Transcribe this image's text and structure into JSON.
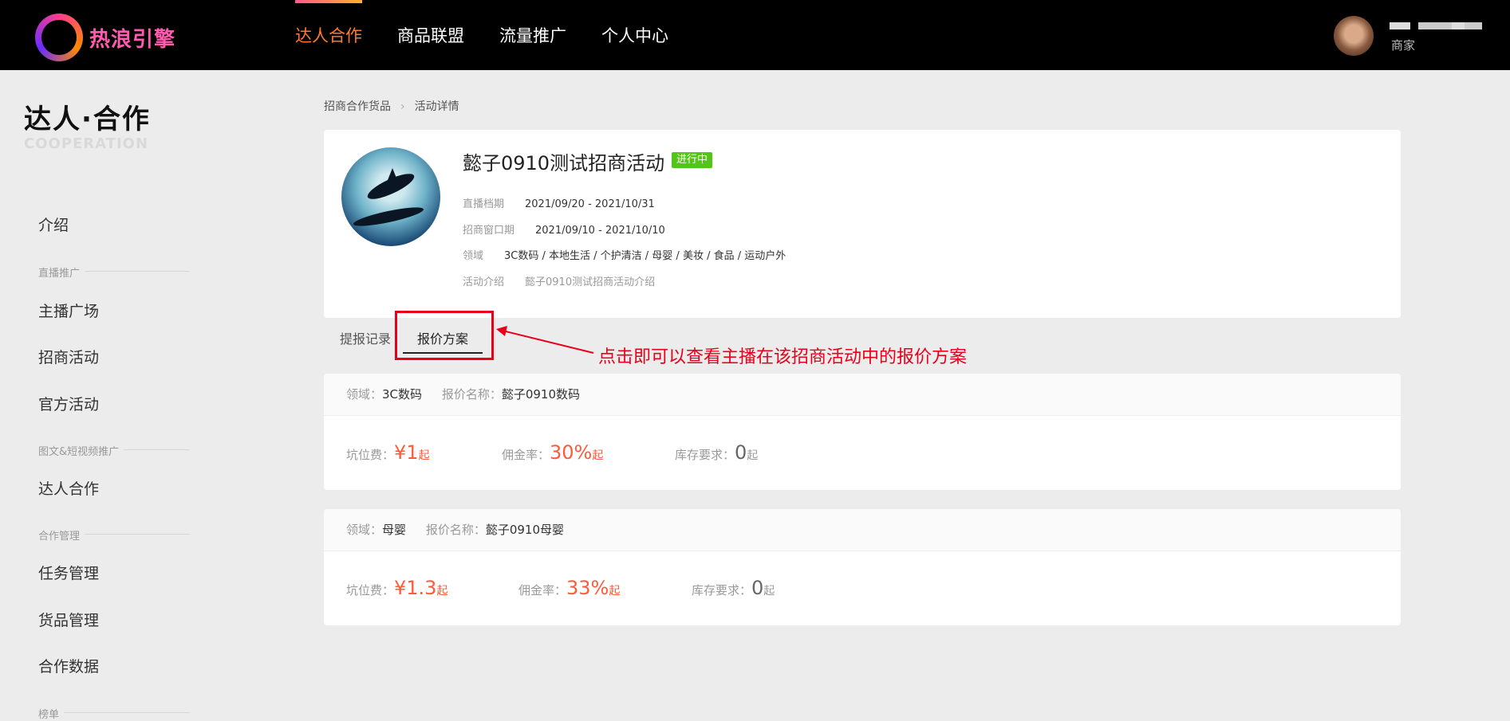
{
  "header": {
    "logo_text": "热浪引擎",
    "nav": [
      {
        "label": "达人合作",
        "active": true
      },
      {
        "label": "商品联盟",
        "active": false
      },
      {
        "label": "流量推广",
        "active": false
      },
      {
        "label": "个人中心",
        "active": false
      }
    ],
    "user_role": "商家"
  },
  "sidebar": {
    "title": "达人·合作",
    "subtitle": "COOPERATION",
    "intro": "介绍",
    "group_live": "直播推广",
    "live_items": [
      "主播广场",
      "招商活动",
      "官方活动"
    ],
    "group_video": "图文&短视频推广",
    "video_items": [
      "达人合作"
    ],
    "group_manage": "合作管理",
    "manage_items": [
      "任务管理",
      "货品管理",
      "合作数据"
    ],
    "group_more": "榜单"
  },
  "breadcrumb": {
    "parent": "招商合作货品",
    "current": "活动详情"
  },
  "activity": {
    "title": "懿子0910测试招商活动",
    "status": "进行中",
    "rows": [
      {
        "key": "直播档期",
        "value": "2021/09/20 - 2021/10/31"
      },
      {
        "key": "招商窗口期",
        "value": "2021/09/10 - 2021/10/10"
      },
      {
        "key": "领域",
        "value": "3C数码 / 本地生活 / 个护清洁 / 母婴 / 美妆 / 食品 / 运动户外"
      },
      {
        "key": "活动介绍",
        "value": "懿子0910测试招商活动介绍"
      }
    ]
  },
  "tabs": [
    {
      "label": "提报记录",
      "active": false
    },
    {
      "label": "报价方案",
      "active": true
    }
  ],
  "annotation": "点击即可以查看主播在该招商活动中的报价方案",
  "quotes": [
    {
      "domain_key": "领域：",
      "domain": "3C数码",
      "name_key": "报价名称：",
      "name": "懿子0910数码",
      "slot_fee_key": "坑位费：",
      "slot_fee": "¥1",
      "slot_unit": "起",
      "commission_key": "佣金率：",
      "commission": "30%",
      "commission_unit": "起",
      "stock_key": "库存要求：",
      "stock": "0",
      "stock_unit": "起"
    },
    {
      "domain_key": "领域：",
      "domain": "母婴",
      "name_key": "报价名称：",
      "name": "懿子0910母婴",
      "slot_fee_key": "坑位费：",
      "slot_fee": "¥1.3",
      "slot_unit": "起",
      "commission_key": "佣金率：",
      "commission": "33%",
      "commission_unit": "起",
      "stock_key": "库存要求：",
      "stock": "0",
      "stock_unit": "起"
    }
  ]
}
